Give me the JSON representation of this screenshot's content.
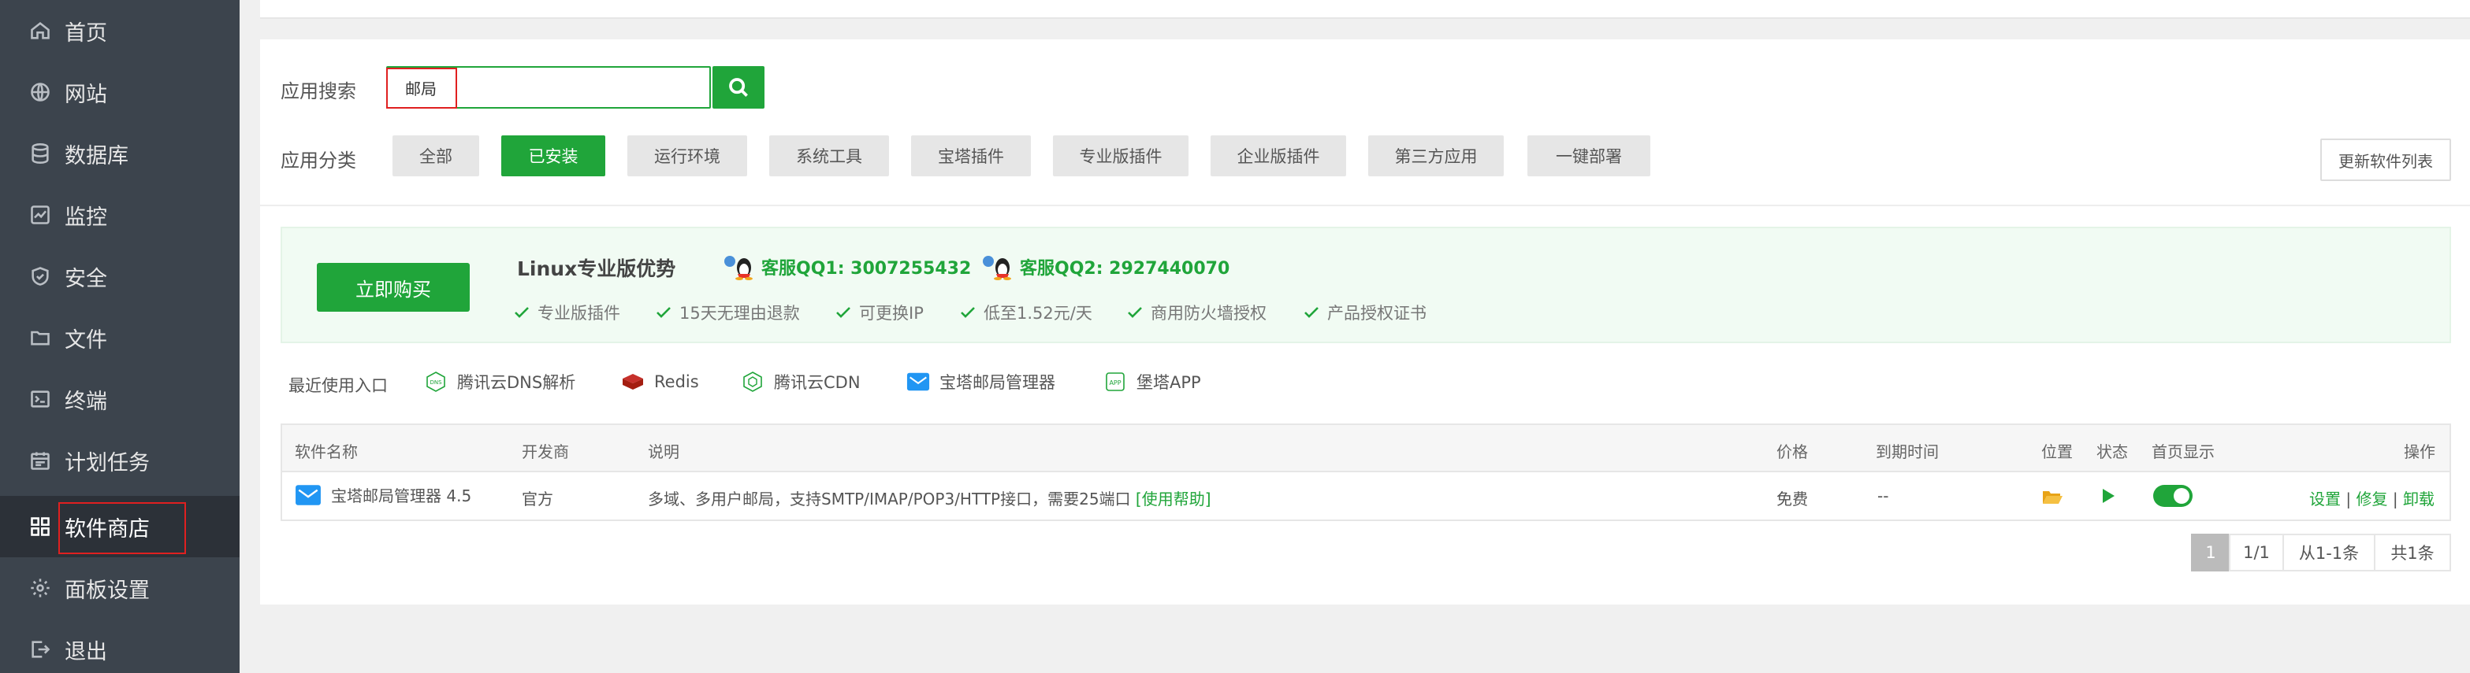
{
  "sidebar": {
    "items": [
      {
        "label": "首页",
        "icon": "home-icon"
      },
      {
        "label": "网站",
        "icon": "globe-icon"
      },
      {
        "label": "数据库",
        "icon": "database-icon"
      },
      {
        "label": "监控",
        "icon": "monitor-icon"
      },
      {
        "label": "安全",
        "icon": "shield-icon"
      },
      {
        "label": "文件",
        "icon": "folder-icon"
      },
      {
        "label": "终端",
        "icon": "terminal-icon"
      },
      {
        "label": "计划任务",
        "icon": "calendar-icon"
      },
      {
        "label": "软件商店",
        "icon": "apps-icon",
        "active": true
      },
      {
        "label": "面板设置",
        "icon": "gear-icon"
      },
      {
        "label": "退出",
        "icon": "logout-icon"
      }
    ]
  },
  "search": {
    "label": "应用搜索",
    "value": "邮局"
  },
  "categories": {
    "label": "应用分类",
    "items": [
      "全部",
      "已安装",
      "运行环境",
      "系统工具",
      "宝塔插件",
      "专业版插件",
      "企业版插件",
      "第三方应用",
      "一键部署"
    ],
    "active": "已安装",
    "refresh_label": "更新软件列表"
  },
  "promo": {
    "buy_label": "立即购买",
    "title": "Linux专业版优势",
    "qq1": "客服QQ1: 3007255432",
    "qq2": "客服QQ2: 2927440070",
    "features": [
      "专业版插件",
      "15天无理由退款",
      "可更换IP",
      "低至1.52元/天",
      "商用防火墙授权",
      "产品授权证书"
    ]
  },
  "recent": {
    "label": "最近使用入口",
    "items": [
      "腾讯云DNS解析",
      "Redis",
      "腾讯云CDN",
      "宝塔邮局管理器",
      "堡塔APP"
    ]
  },
  "table": {
    "headers": {
      "name": "软件名称",
      "developer": "开发商",
      "description": "说明",
      "price": "价格",
      "expiry": "到期时间",
      "location": "位置",
      "status": "状态",
      "homepage": "首页显示",
      "actions": "操作"
    },
    "rows": [
      {
        "name": "宝塔邮局管理器 4.5",
        "developer": "官方",
        "description": "多域、多用户邮局，支持SMTP/IMAP/POP3/HTTP接口，需要25端口",
        "help": "[使用帮助]",
        "price": "免费",
        "expiry": "--",
        "homepage_on": true,
        "action_settings": "设置",
        "action_repair": "修复",
        "action_uninstall": "卸载",
        "sep": "|"
      }
    ]
  },
  "pagination": {
    "current": "1",
    "pages": "1/1",
    "range": "从1-1条",
    "total": "共1条"
  },
  "colors": {
    "accent": "#20a53a",
    "sidebar_bg": "#3c444d",
    "highlight": "#e02020"
  }
}
